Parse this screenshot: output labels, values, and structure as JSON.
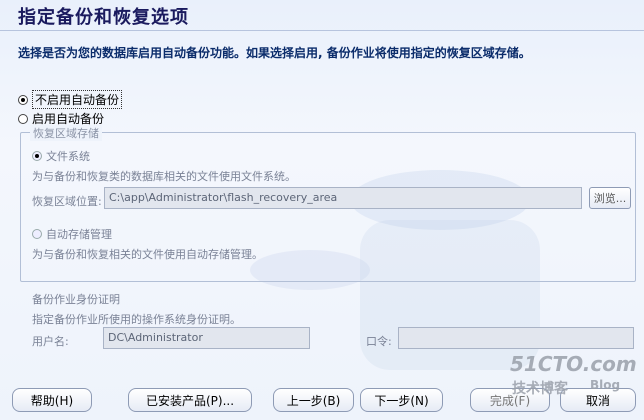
{
  "title": "指定备份和恢复选项",
  "description": "选择是否为您的数据库启用自动备份功能。如果选择启用, 备份作业将使用指定的恢复区域存储。",
  "options": {
    "disable_label": "不启用自动备份",
    "enable_label": "启用自动备份"
  },
  "recovery": {
    "legend": "恢复区域存储",
    "fs_label": "文件系统",
    "fs_desc": "为与备份和恢复类的数据库相关的文件使用文件系统。",
    "location_label": "恢复区域位置:",
    "location_value": "C:\\app\\Administrator\\flash_recovery_area",
    "browse_label": "浏览...",
    "asm_label": "自动存储管理",
    "asm_desc": "为与备份和恢复相关的文件使用自动存储管理。"
  },
  "credentials": {
    "heading": "备份作业身份证明",
    "desc": "指定备份作业所使用的操作系统身份证明。",
    "user_label": "用户名:",
    "user_value": "DC\\Administrator",
    "password_label": "口令:",
    "password_value": ""
  },
  "buttons": {
    "help": "帮助(H)",
    "installed": "已安装产品(P)...",
    "back": "上一步(B)",
    "next": "下一步(N)",
    "finish": "完成(F)",
    "cancel": "取消"
  },
  "watermark": {
    "line1": "51CTO.com",
    "line2": "技术博客",
    "line3": "Blog"
  }
}
